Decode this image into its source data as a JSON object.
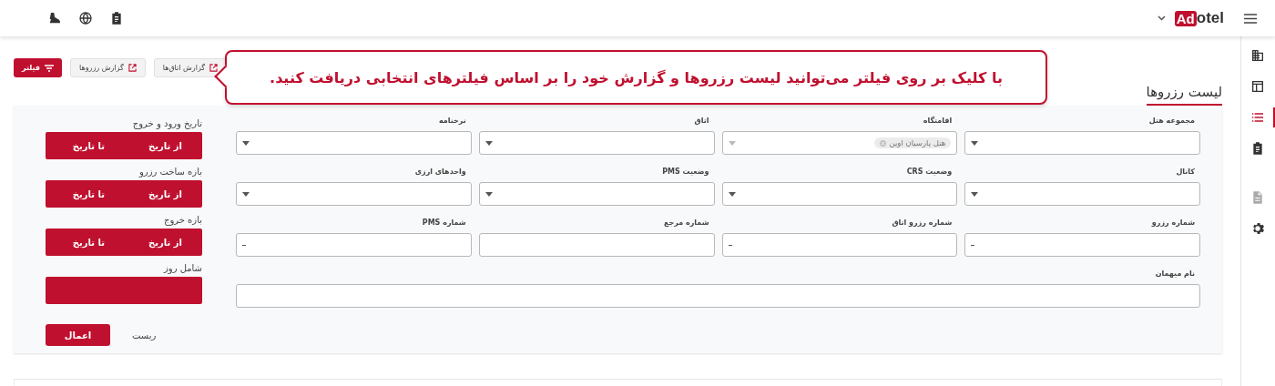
{
  "topbar": {
    "logo": {
      "mark": "Ad",
      "text": "otel"
    },
    "left_icons": [
      {
        "kind": "boot"
      },
      {
        "kind": "globe"
      },
      {
        "kind": "clipboard"
      }
    ]
  },
  "sidebar": {
    "items": [
      {
        "kind": "building",
        "selected": false,
        "disabled": false
      },
      {
        "kind": "table",
        "selected": false,
        "disabled": false
      },
      {
        "kind": "list",
        "selected": true,
        "disabled": false
      },
      {
        "kind": "clipboard",
        "selected": false,
        "disabled": false
      },
      {
        "kind": "document",
        "selected": false,
        "disabled": true
      },
      {
        "kind": "gear",
        "selected": false,
        "disabled": false
      }
    ]
  },
  "page": {
    "title": "لیست رزروها",
    "buttons": [
      {
        "label": "گزارش اتاق‌ها",
        "kind": "report"
      },
      {
        "label": "گزارش رزروها",
        "kind": "report"
      },
      {
        "label": "فیلتر",
        "kind": "filter"
      }
    ]
  },
  "tooltip": {
    "text": "با کلیک بر روی فیلتر می‌توانید لیست رزروها و گزارش خود را بر اساس فیلترهای انتخابی دریافت کنید."
  },
  "filters": {
    "fields": [
      {
        "label": "مجموعه هتل",
        "kind": "select"
      },
      {
        "label": "اقامتگاه",
        "kind": "select",
        "chips": [
          "هتل پارسیان اوین"
        ]
      },
      {
        "label": "اتاق",
        "kind": "select"
      },
      {
        "label": "نرخنامه",
        "kind": "select"
      },
      {
        "label": "کانال",
        "kind": "select"
      },
      {
        "label": "وضعیت CRS",
        "kind": "select"
      },
      {
        "label": "وضعیت PMS",
        "kind": "select"
      },
      {
        "label": "واحدهای ارزی",
        "kind": "select"
      },
      {
        "label": "شماره رزرو",
        "kind": "number"
      },
      {
        "label": "شماره رزرو اتاق",
        "kind": "number"
      },
      {
        "label": "شماره مرجع",
        "kind": "text"
      },
      {
        "label": "شماره PMS",
        "kind": "number"
      },
      {
        "label": "نام میهمان",
        "kind": "wide"
      }
    ],
    "date_ranges": [
      {
        "label": "تاریخ ورود و خروج",
        "from": "از تاریخ",
        "to": "تا تاریخ"
      },
      {
        "label": "بازه ساخت رزرو",
        "from": "از تاریخ",
        "to": "تا تاریخ"
      },
      {
        "label": "بازه خروج",
        "from": "از تاریخ",
        "to": "تا تاریخ"
      },
      {
        "label": "شامل روز"
      }
    ],
    "apply": "اعمال",
    "reset": "ریست"
  }
}
